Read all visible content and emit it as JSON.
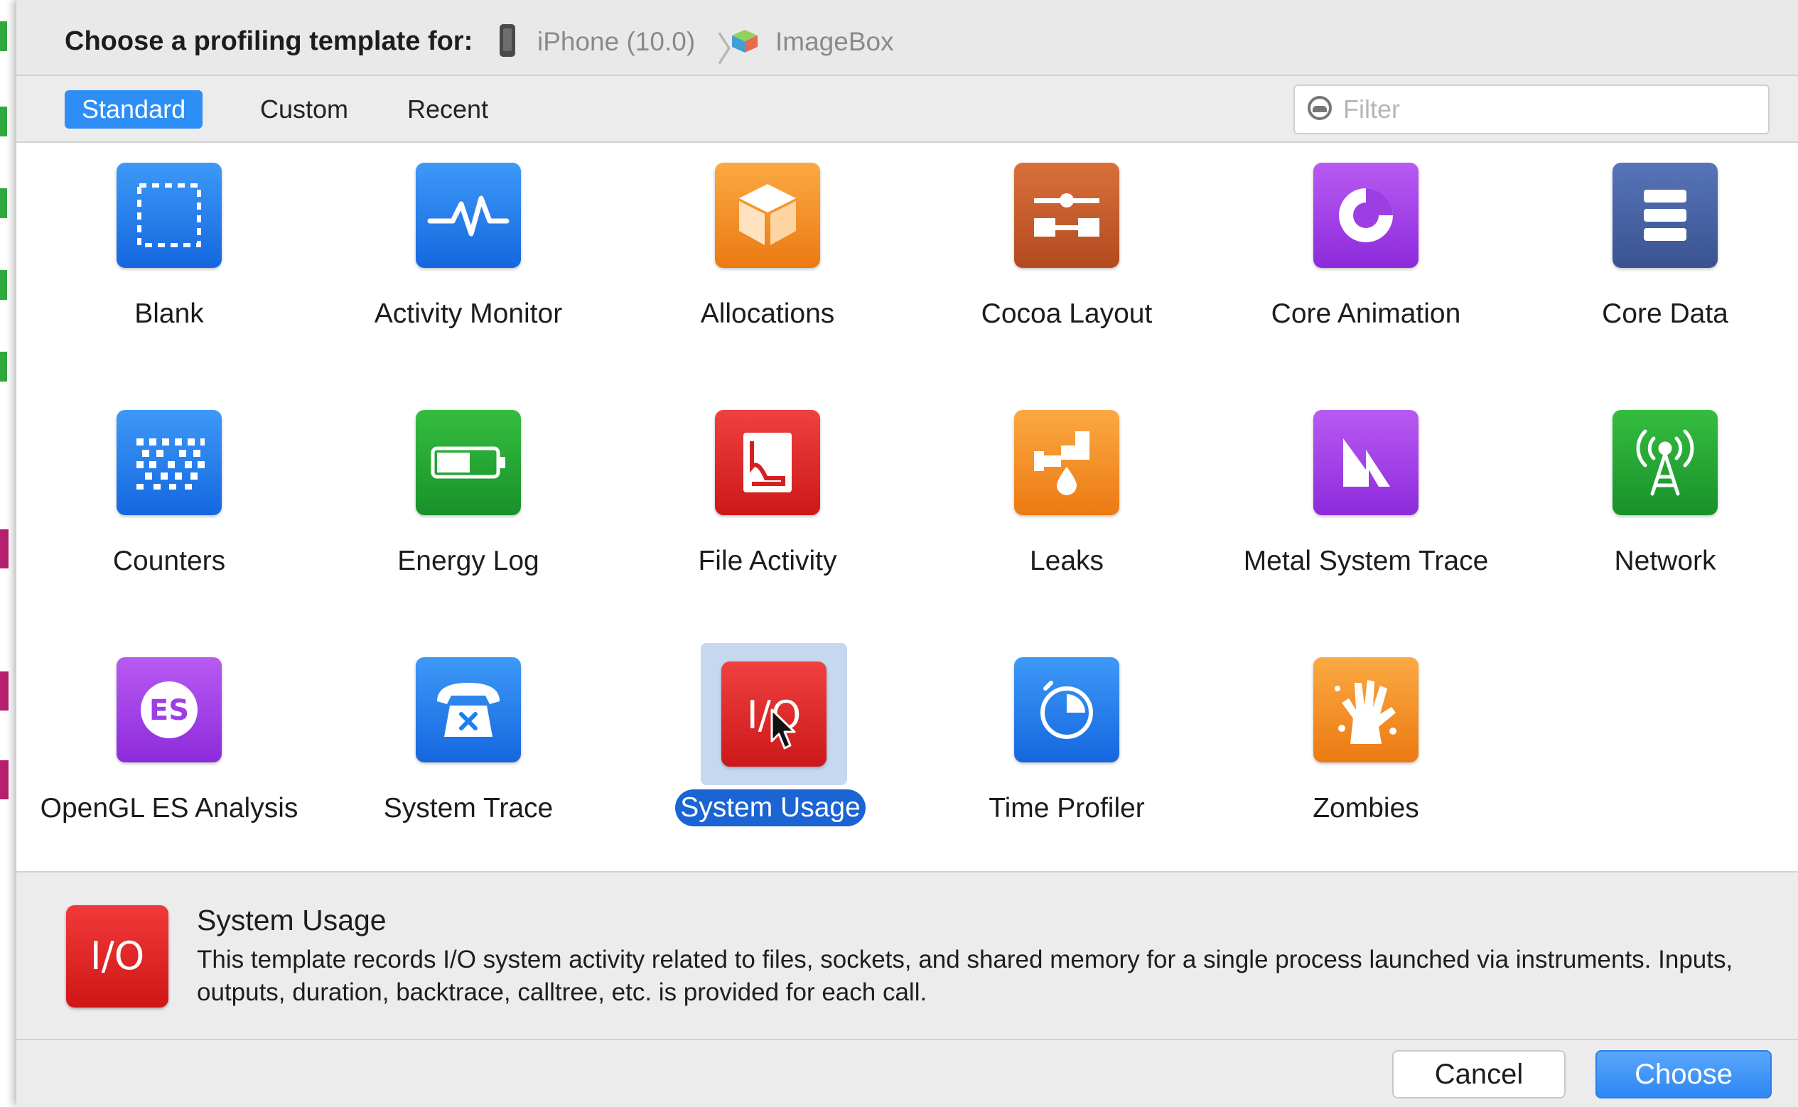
{
  "header": {
    "title": "Choose a profiling template for:",
    "device": "iPhone (10.0)",
    "app": "ImageBox"
  },
  "tabs": [
    {
      "label": "Standard",
      "active": true
    },
    {
      "label": "Custom",
      "active": false
    },
    {
      "label": "Recent",
      "active": false
    }
  ],
  "filter": {
    "placeholder": "Filter",
    "value": ""
  },
  "templates": [
    {
      "label": "Blank",
      "icon": "blank-icon",
      "color": "#1f7ff2"
    },
    {
      "label": "Activity Monitor",
      "icon": "activity-monitor-icon",
      "color": "#1f7ff2"
    },
    {
      "label": "Allocations",
      "icon": "allocations-icon",
      "color": "#f38b22"
    },
    {
      "label": "Cocoa Layout",
      "icon": "cocoa-layout-icon",
      "color": "#c4592a"
    },
    {
      "label": "Core Animation",
      "icon": "core-animation-icon",
      "color": "#a33de8"
    },
    {
      "label": "Core Data",
      "icon": "core-data-icon",
      "color": "#4662a5"
    },
    {
      "label": "Counters",
      "icon": "counters-icon",
      "color": "#1f7ff2"
    },
    {
      "label": "Energy Log",
      "icon": "energy-log-icon",
      "color": "#1fa52e"
    },
    {
      "label": "File Activity",
      "icon": "file-activity-icon",
      "color": "#e02626"
    },
    {
      "label": "Leaks",
      "icon": "leaks-icon",
      "color": "#f38b22"
    },
    {
      "label": "Metal System Trace",
      "icon": "metal-system-trace-icon",
      "color": "#a33de8"
    },
    {
      "label": "Network",
      "icon": "network-icon",
      "color": "#1fa52e"
    },
    {
      "label": "OpenGL ES Analysis",
      "icon": "opengl-es-icon",
      "color": "#a33de8"
    },
    {
      "label": "System Trace",
      "icon": "system-trace-icon",
      "color": "#1f7ff2"
    },
    {
      "label": "System Usage",
      "icon": "system-usage-icon",
      "color": "#e02626",
      "selected": true
    },
    {
      "label": "Time Profiler",
      "icon": "time-profiler-icon",
      "color": "#1f7ff2"
    },
    {
      "label": "Zombies",
      "icon": "zombies-icon",
      "color": "#f38b22"
    }
  ],
  "description": {
    "icon_text": "I/O",
    "title": "System Usage",
    "text": "This template records I/O system activity related to files, sockets, and shared memory for a single process launched via instruments.  Inputs, outputs, duration, backtrace, calltree, etc. is provided for each call."
  },
  "buttons": {
    "cancel": "Cancel",
    "choose": "Choose"
  },
  "icon_glyphs": {
    "es": "ES",
    "io": "I/O"
  }
}
